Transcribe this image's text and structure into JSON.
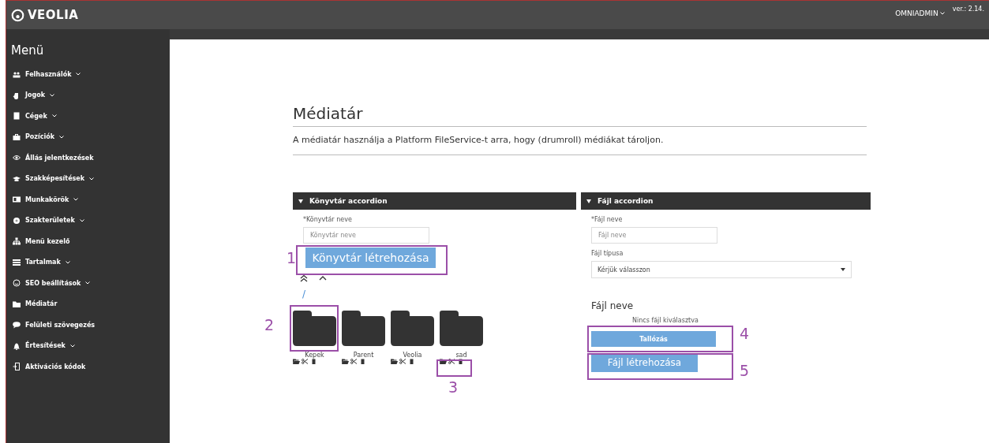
{
  "header": {
    "logo": "VEOLIA",
    "user": "OMNIADMIN",
    "version": "ver.: 2.14."
  },
  "sidebar": {
    "title": "Menü",
    "items": [
      {
        "label": "Felhasználók",
        "expandable": true
      },
      {
        "label": "Jogok",
        "expandable": true
      },
      {
        "label": "Cégek",
        "expandable": true
      },
      {
        "label": "Pozíciók",
        "expandable": true
      },
      {
        "label": "Állás jelentkezések",
        "expandable": false
      },
      {
        "label": "Szakképesítések",
        "expandable": true
      },
      {
        "label": "Munkakörök",
        "expandable": true
      },
      {
        "label": "Szakterületek",
        "expandable": true
      },
      {
        "label": "Menü kezelő",
        "expandable": false
      },
      {
        "label": "Tartalmak",
        "expandable": true
      },
      {
        "label": "SEO beállítások",
        "expandable": true
      },
      {
        "label": "Médiatár",
        "expandable": false
      },
      {
        "label": "Felületi szövegezés",
        "expandable": false
      },
      {
        "label": "Értesítések",
        "expandable": true
      },
      {
        "label": "Aktivációs kódok",
        "expandable": false
      }
    ]
  },
  "page": {
    "title": "Médiatár",
    "description": "A médiatár használja a Platform FileService-t arra, hogy (drumroll) médiákat tároljon."
  },
  "library_panel": {
    "header": "Könyvtár accordion",
    "expanded": true,
    "name_label": "*Könyvtár neve",
    "name_placeholder": "Könyvtár neve",
    "create_button": "Könyvtár létrehozása",
    "path": "/",
    "folders": [
      {
        "name": "Kepek"
      },
      {
        "name": "Parent"
      },
      {
        "name": "Veolia"
      },
      {
        "name": "sad"
      }
    ]
  },
  "file_panel": {
    "header": "Fájl accordion",
    "expanded": true,
    "name_label": "*Fájl neve",
    "name_placeholder": "Fájl neve",
    "type_label": "Fájl típusa",
    "type_placeholder": "Kérjük válasszon",
    "file_heading": "Fájl neve",
    "no_file_text": "Nincs fájl kiválasztva",
    "browse_button": "Tallózás",
    "create_button": "Fájl létrehozása"
  },
  "annotations": [
    {
      "number": "1"
    },
    {
      "number": "2"
    },
    {
      "number": "3"
    },
    {
      "number": "4"
    },
    {
      "number": "5"
    }
  ]
}
